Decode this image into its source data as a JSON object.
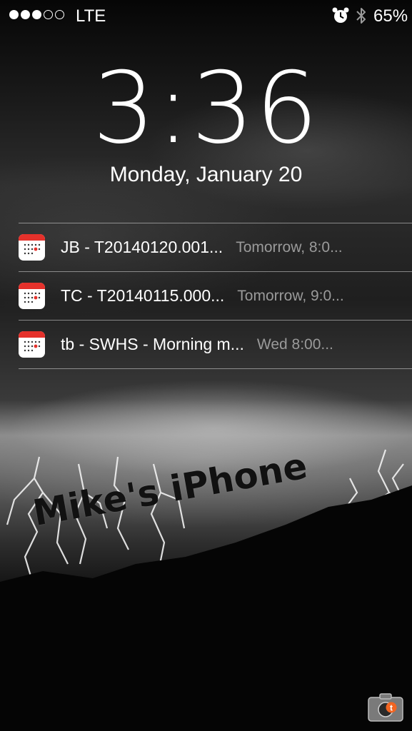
{
  "status_bar": {
    "signal_dots_filled": 3,
    "signal_dots_total": 5,
    "carrier": "LTE",
    "alarm_icon": "alarm-clock-icon",
    "bluetooth_icon": "bluetooth-icon",
    "battery_percent": "65%"
  },
  "lock_screen": {
    "time": "3:36",
    "date": "Monday, January 20"
  },
  "notifications": [
    {
      "app_icon": "calendar-icon",
      "title": "JB - T20140120.001...",
      "time": "Tomorrow, 8:0..."
    },
    {
      "app_icon": "calendar-icon",
      "title": "TC - T20140115.000...",
      "time": "Tomorrow, 9:0..."
    },
    {
      "app_icon": "calendar-icon",
      "title": "tb - SWHS - Morning m...",
      "time": "Wed 8:00..."
    }
  ],
  "wallpaper": {
    "device_name_text": "Mike's iPhone"
  },
  "camera_grabber": {
    "icon": "camera-icon",
    "badge_color": "#f26522"
  }
}
